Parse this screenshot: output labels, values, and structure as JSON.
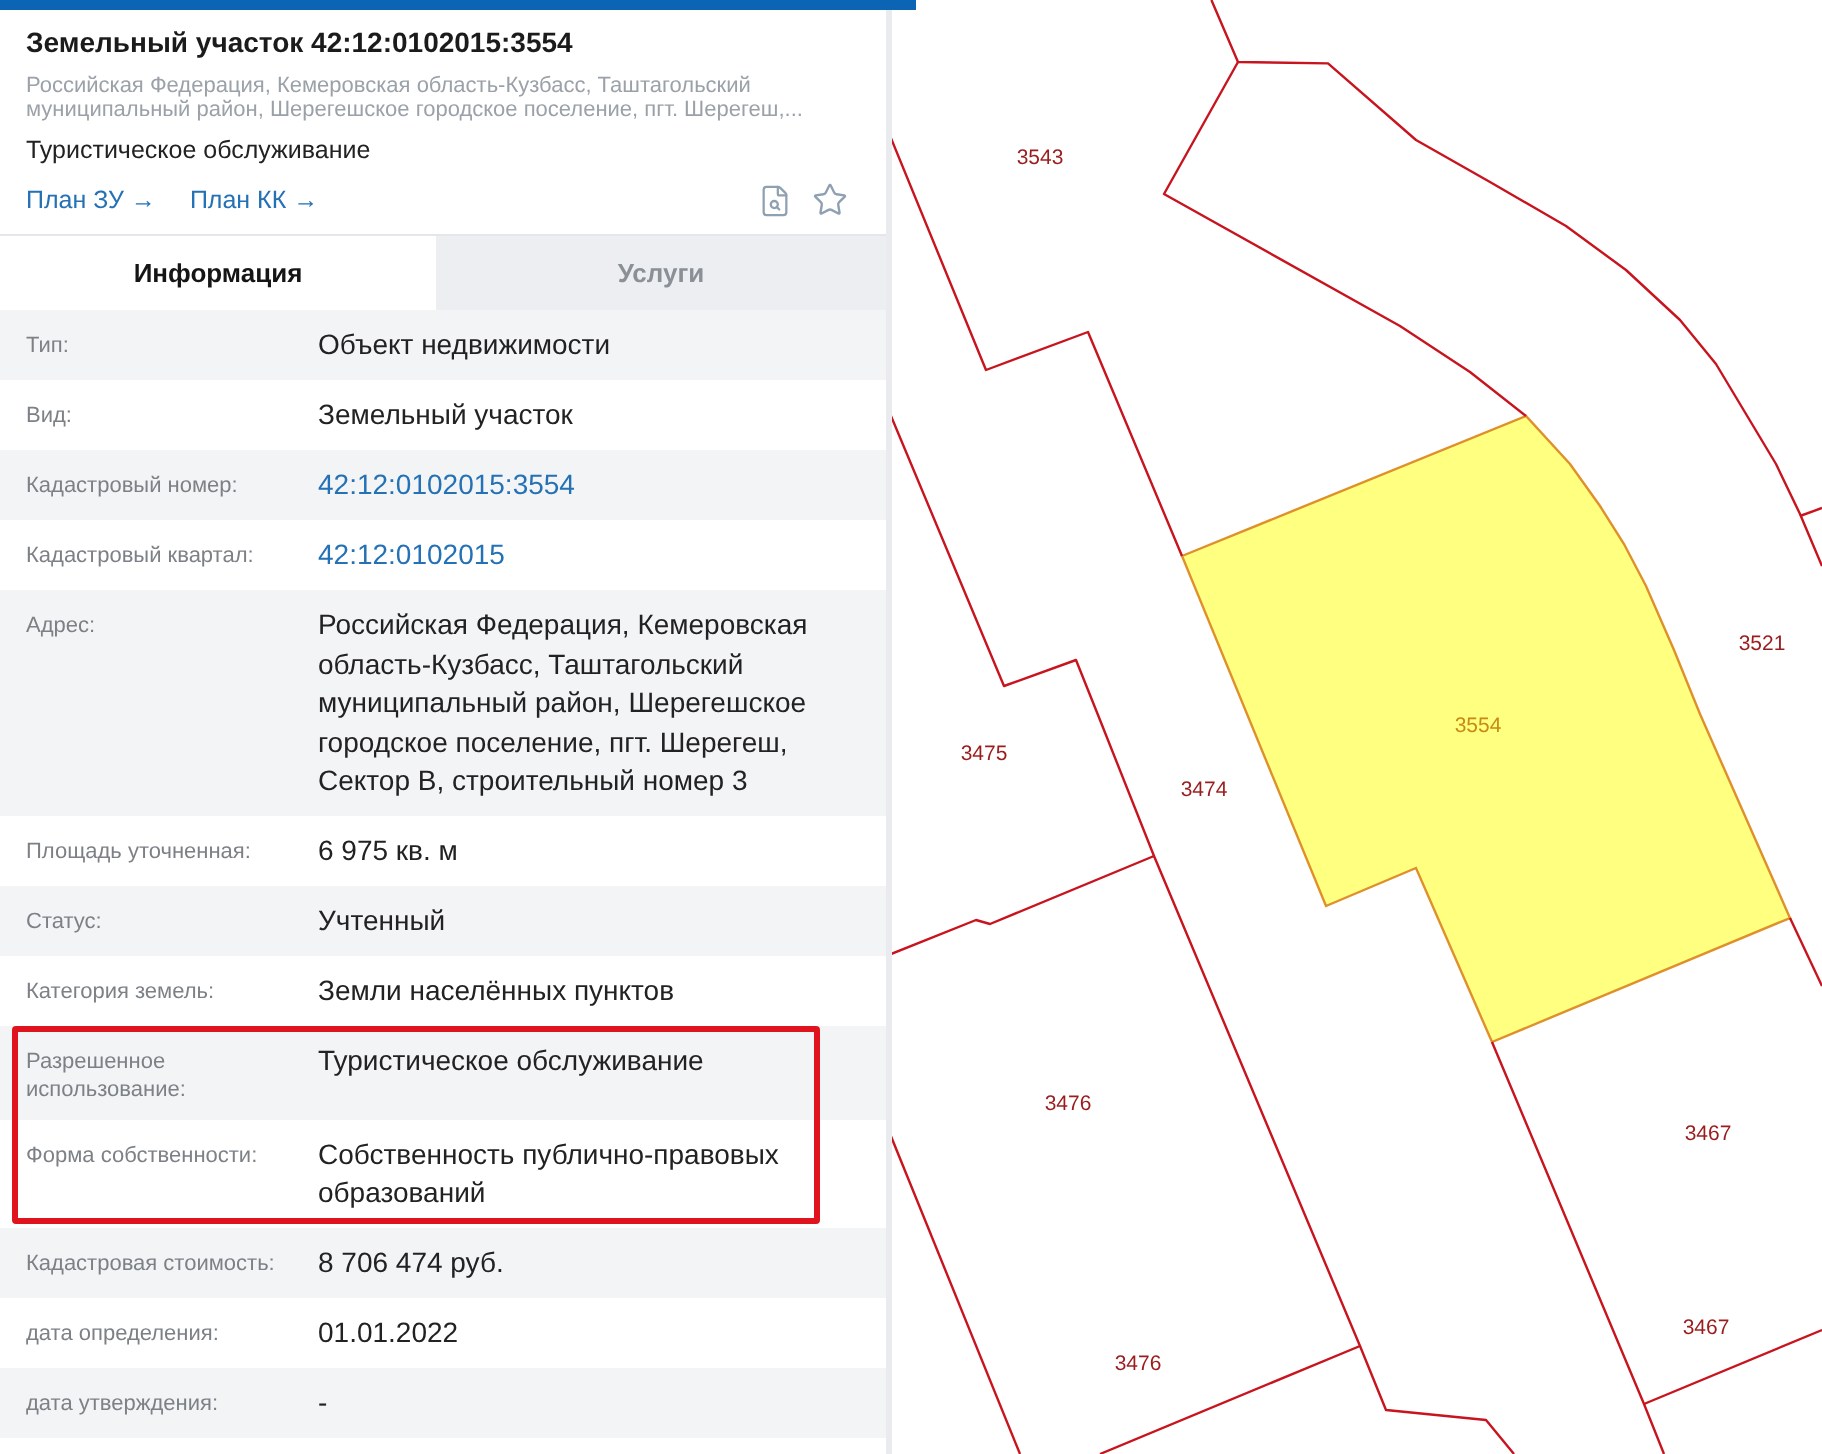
{
  "card": {
    "title": "Земельный участок 42:12:0102015:3554",
    "address": "Российская Федерация, Кемеровская область-Кузбасс, Таштагольский муниципальный район, Шерегешское городское поселение, пгт. Шерегеш,...",
    "usage": "Туристическое обслуживание",
    "links": [
      {
        "label": "План ЗУ →"
      },
      {
        "label": "План КК →"
      }
    ]
  },
  "tabs": [
    {
      "label": "Информация",
      "selected": true
    },
    {
      "label": "Услуги",
      "selected": false
    }
  ],
  "info": {
    "rows": [
      {
        "label": "Тип:",
        "value": "Объект недвижимости",
        "kind": "text",
        "highlighted": false
      },
      {
        "label": "Вид:",
        "value": "Земельный участок",
        "kind": "text",
        "highlighted": false
      },
      {
        "label": "Кадастровый номер:",
        "value": "42:12:0102015:3554",
        "kind": "link",
        "highlighted": false
      },
      {
        "label": "Кадастровый квартал:",
        "value": "42:12:0102015",
        "kind": "link",
        "highlighted": false
      },
      {
        "label": "Адрес:",
        "value": "Российская Федерация, Кемеровская область-Кузбасс, Таштагольский муниципальный район, Шерегешское городское поселение, пгт. Шерегеш, Сектор В, строительный номер 3",
        "kind": "text",
        "highlighted": false
      },
      {
        "label": "Площадь уточненная:",
        "value": "6 975 кв. м",
        "kind": "text",
        "highlighted": false
      },
      {
        "label": "Статус:",
        "value": "Учтенный",
        "kind": "text",
        "highlighted": false
      },
      {
        "label": "Категория земель:",
        "value": "Земли населённых пунктов",
        "kind": "text",
        "highlighted": false
      },
      {
        "label": "Разрешенное использование:",
        "value": "Туристическое обслуживание",
        "kind": "text",
        "highlighted": true
      },
      {
        "label": "Форма собственности:",
        "value": "Собственность публично-правовых образований",
        "kind": "text",
        "highlighted": true
      },
      {
        "label": "Кадастровая стоимость:",
        "value": "8 706 474 руб.",
        "kind": "text",
        "highlighted": false
      },
      {
        "label": "дата определения:",
        "value": "01.01.2022",
        "kind": "text",
        "highlighted": false
      },
      {
        "label": "дата утверждения:",
        "value": "-",
        "kind": "text",
        "highlighted": false
      }
    ]
  },
  "map": {
    "parcels": [
      {
        "number": "3543",
        "selected": false
      },
      {
        "number": "3521",
        "selected": false
      },
      {
        "number": "3554",
        "selected": true
      },
      {
        "number": "3475",
        "selected": false
      },
      {
        "number": "3474",
        "selected": false
      },
      {
        "number": "3476",
        "selected": false
      },
      {
        "number": "3467",
        "selected": false
      },
      {
        "number": "3467",
        "selected": false
      },
      {
        "number": "3476",
        "selected": false
      }
    ]
  }
}
